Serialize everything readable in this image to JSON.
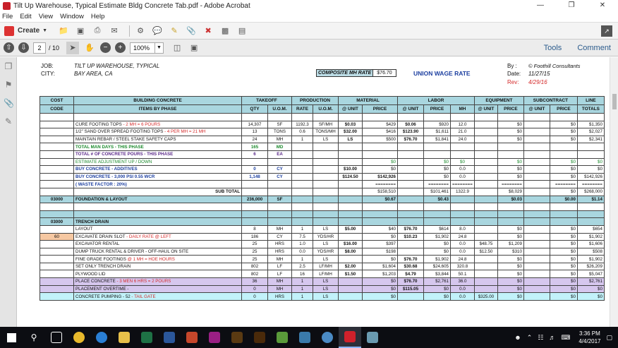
{
  "window": {
    "title": "Tilt Up Warehouse, Typical Estimate Bldg Concrete Tab.pdf - Adobe Acrobat"
  },
  "menu": [
    "File",
    "Edit",
    "View",
    "Window",
    "Help"
  ],
  "toolbar": {
    "create_label": "Create",
    "page_current": "2",
    "page_total": "/ 10",
    "zoom": "100%",
    "tools_label": "Tools",
    "comment_label": "Comment"
  },
  "header": {
    "job_label": "JOB:",
    "job_value": "TILT UP WAREHOUSE, TYPICAL",
    "city_label": "CITY:",
    "city_value": "BAY AREA, CA",
    "composite_label": "COMPOSITE MH RATE",
    "composite_value": "$76.70",
    "union_label": "UNION WAGE RATE",
    "by_label": "By :",
    "by_value": "© Foothill Consultants",
    "date_label": "Date:",
    "date_value": "11/27/15",
    "rev_label": "Rev:",
    "rev_value": "4/29/16"
  },
  "table": {
    "head1": [
      "COST",
      "BUILDING CONCRETE",
      "TAKEOFF",
      "PRODUCTION",
      "MATERIAL",
      "LABOR",
      "EQUIPMENT",
      "SUBCONTRACT",
      "LINE"
    ],
    "head2": [
      "CODE",
      "ITEMS BY PHASE",
      "QTY",
      "U.O.M.",
      "RATE",
      "U.O.M.",
      "@ UNIT",
      "PRICE",
      "@ UNIT",
      "PRICE",
      "MH",
      "@ UNIT",
      "PRICE",
      "@ UNIT",
      "PRICE",
      "TOTALS"
    ],
    "rows": [
      {
        "style": "blank",
        "cells": [
          "",
          "",
          "",
          "",
          "",
          "",
          "",
          "",
          "",
          "",
          "",
          "",
          "",
          "",
          "",
          ""
        ]
      },
      {
        "style": "",
        "cells": [
          "",
          "CURE FOOTING TOPS",
          "14,307",
          "SF",
          "1192.3",
          "SF/MH",
          "$0.03",
          "$429",
          "$0.06",
          "$920",
          "12.0",
          "",
          "$0",
          "",
          "$0",
          "$1,350"
        ],
        "note": " - 2 MH = 6 POURS"
      },
      {
        "style": "",
        "cells": [
          "",
          "1/2\" SAND OVER SPREAD FOOTING TOPS",
          "13",
          "TONS",
          "0.6",
          "TONS/MH",
          "$32.00",
          "$416",
          "$123.90",
          "$1,611",
          "21.0",
          "",
          "$0",
          "",
          "$0",
          "$2,027"
        ],
        "note": " - 4 PER MH = 21 MH"
      },
      {
        "style": "",
        "cells": [
          "",
          "MAINTAIN REBAR / STEEL STAKE SAFETY CAPS",
          "24",
          "MH",
          "1",
          "LS",
          "LS",
          "$500",
          "$76.70",
          "$1,841",
          "24.0",
          "",
          "$0",
          "",
          "$0",
          "$2,341"
        ]
      },
      {
        "style": "grn",
        "cells": [
          "",
          "TOTAL MAN DAYS - THIS PHASE",
          "165",
          "MD",
          "",
          "",
          "",
          "",
          "",
          "",
          "",
          "",
          "",
          "",
          "",
          ""
        ]
      },
      {
        "style": "red",
        "cells": [
          "",
          "TOTAL # OF CONCRETE POURS - THIS PHASE",
          "6",
          "EA",
          "",
          "",
          "",
          "",
          "",
          "",
          "",
          "",
          "",
          "",
          "",
          ""
        ]
      },
      {
        "style": "grn",
        "cells": [
          "",
          "ESTIMATE ADJUSTMENT UP / DOWN",
          "",
          "",
          "",
          "",
          "",
          "$0",
          "",
          "$0",
          "$0",
          "",
          "$0",
          "",
          "$0",
          "$0"
        ]
      },
      {
        "style": "blu",
        "cells": [
          "",
          "BUY CONCRETE - ADDITIVES",
          "0",
          "CY",
          "",
          "",
          "$10.00",
          "$0",
          "",
          "$0",
          "0.0",
          "",
          "$0",
          "",
          "$0",
          "$0"
        ]
      },
      {
        "style": "blu",
        "cells": [
          "",
          "BUY CONCRETE - 3,000 PSI 0.55 WCR",
          "1,148",
          "CY",
          "",
          "",
          "$124.50",
          "$142,926",
          "",
          "$0",
          "0.0",
          "",
          "$0",
          "",
          "$0",
          "$142,926"
        ]
      },
      {
        "style": "blu",
        "cells": [
          "",
          "( WASTE FACTOR : 20%)",
          "",
          "",
          "",
          "",
          "",
          "========",
          "",
          "========",
          "========",
          "",
          "========",
          "",
          "========",
          "========"
        ]
      },
      {
        "style": "sub",
        "cells": [
          "",
          "SUB TOTAL",
          "",
          "",
          "",
          "",
          "",
          "$158,510",
          "",
          "$101,461",
          "1322.9",
          "",
          "$8,029",
          "",
          "$0",
          "$268,000"
        ]
      },
      {
        "style": "tot",
        "cells": [
          "03000",
          "FOUNDATION & LAYOUT",
          "236,000",
          "SF",
          "",
          "",
          "",
          "$0.67",
          "",
          "$0.43",
          "",
          "",
          "$0.03",
          "",
          "$0.00",
          "$1.14"
        ]
      },
      {
        "style": "blank",
        "cells": [
          "",
          "",
          "",
          "",
          "",
          "",
          "",
          "",
          "",
          "",
          "",
          "",
          "",
          "",
          "",
          ""
        ]
      },
      {
        "style": "band",
        "cells": [
          "",
          "",
          "",
          "",
          "",
          "",
          "",
          "",
          "",
          "",
          "",
          "",
          "",
          "",
          "",
          ""
        ]
      },
      {
        "style": "trench",
        "cells": [
          "03000",
          "TRENCH DRAIN",
          "",
          "",
          "",
          "",
          "",
          "",
          "",
          "",
          "",
          "",
          "",
          "",
          "",
          ""
        ]
      },
      {
        "style": "",
        "cells": [
          "",
          "LAYOUT",
          "8",
          "MH",
          "1",
          "LS",
          "$5.00",
          "$40",
          "$76.70",
          "$614",
          "8.0",
          "",
          "$0",
          "",
          "$0",
          "$654"
        ]
      },
      {
        "style": "",
        "cells": [
          "60",
          "EXCAVATE DRAIN SLOT",
          "186",
          "CY",
          "7.5",
          "YDS/HR",
          "",
          "$0",
          "$10.23",
          "$1,902",
          "24.8",
          "",
          "$0",
          "",
          "$0",
          "$1,902"
        ],
        "note": " - DAILY RATE @ LEFT"
      },
      {
        "style": "",
        "cells": [
          "",
          "EXCAVATOR RENTAL",
          "25",
          "HRS",
          "1.0",
          "LS",
          "$16.00",
          "$397",
          "",
          "$0",
          "0.0",
          "$48.75",
          "$1,209",
          "",
          "$0",
          "$1,606"
        ]
      },
      {
        "style": "",
        "cells": [
          "",
          "DUMP TRUCK RENTAL & DRIVER - OFF-HAUL ON SITE",
          "25",
          "HRS",
          "0.0",
          "YDS/HR",
          "$8.00",
          "$198",
          "",
          "$0",
          "0.0",
          "$12.50",
          "$310",
          "",
          "$0",
          "$508"
        ]
      },
      {
        "style": "",
        "cells": [
          "",
          "FINE GRADE FOOTINGS",
          "25",
          "MH",
          "1",
          "LS",
          "",
          "$0",
          "$76.70",
          "$1,902",
          "24.8",
          "",
          "$0",
          "",
          "$0",
          "$1,902"
        ],
        "note": " @ 1 MH = HOE HOURS"
      },
      {
        "style": "",
        "cells": [
          "",
          "SET ONLY TRENCH DRAIN",
          "802",
          "LF",
          "2.5",
          "LF/MH",
          "$2.00",
          "$1,604",
          "$30.68",
          "$24,605",
          "320.8",
          "",
          "$0",
          "",
          "$0",
          "$26,209"
        ]
      },
      {
        "style": "",
        "cells": [
          "",
          "PLYWOOD LID",
          "802",
          "LF",
          "16",
          "LF/MH",
          "$1.50",
          "$1,203",
          "$4.79",
          "$3,844",
          "50.1",
          "",
          "$0",
          "",
          "$0",
          "$5,047"
        ]
      },
      {
        "style": "lav",
        "cells": [
          "",
          "PLACE CONCRETE",
          "36",
          "MH",
          "1",
          "LS",
          "",
          "$0",
          "$76.70",
          "$2,761",
          "36.0",
          "",
          "$0",
          "",
          "$0",
          "$2,761"
        ],
        "note": " - 3 MEN 6 HRS = 2 POURS"
      },
      {
        "style": "lav",
        "cells": [
          "",
          "PLACEMENT OVERTIME -",
          "0",
          "MH",
          "1",
          "LS",
          "",
          "$0",
          "$115.05",
          "$0",
          "0.0",
          "",
          "$0",
          "",
          "$0",
          "$0"
        ]
      },
      {
        "style": "cyan",
        "cells": [
          "",
          "CONCRETE PUMPING - 52",
          "0",
          "HRS",
          "1",
          "LS",
          "",
          "$0",
          "",
          "$0",
          "0.0",
          "$325.00",
          "$0",
          "",
          "$0",
          "$0"
        ],
        "note": " - TAIL GATE"
      }
    ]
  },
  "taskbar": {
    "time": "3:36 PM",
    "date": "4/4/2017"
  },
  "colors": {
    "header_teal": "#a9d6df",
    "lavender": "#d6c7ee",
    "cyan": "#c2f2fa",
    "orange": "#f6c8a2"
  }
}
